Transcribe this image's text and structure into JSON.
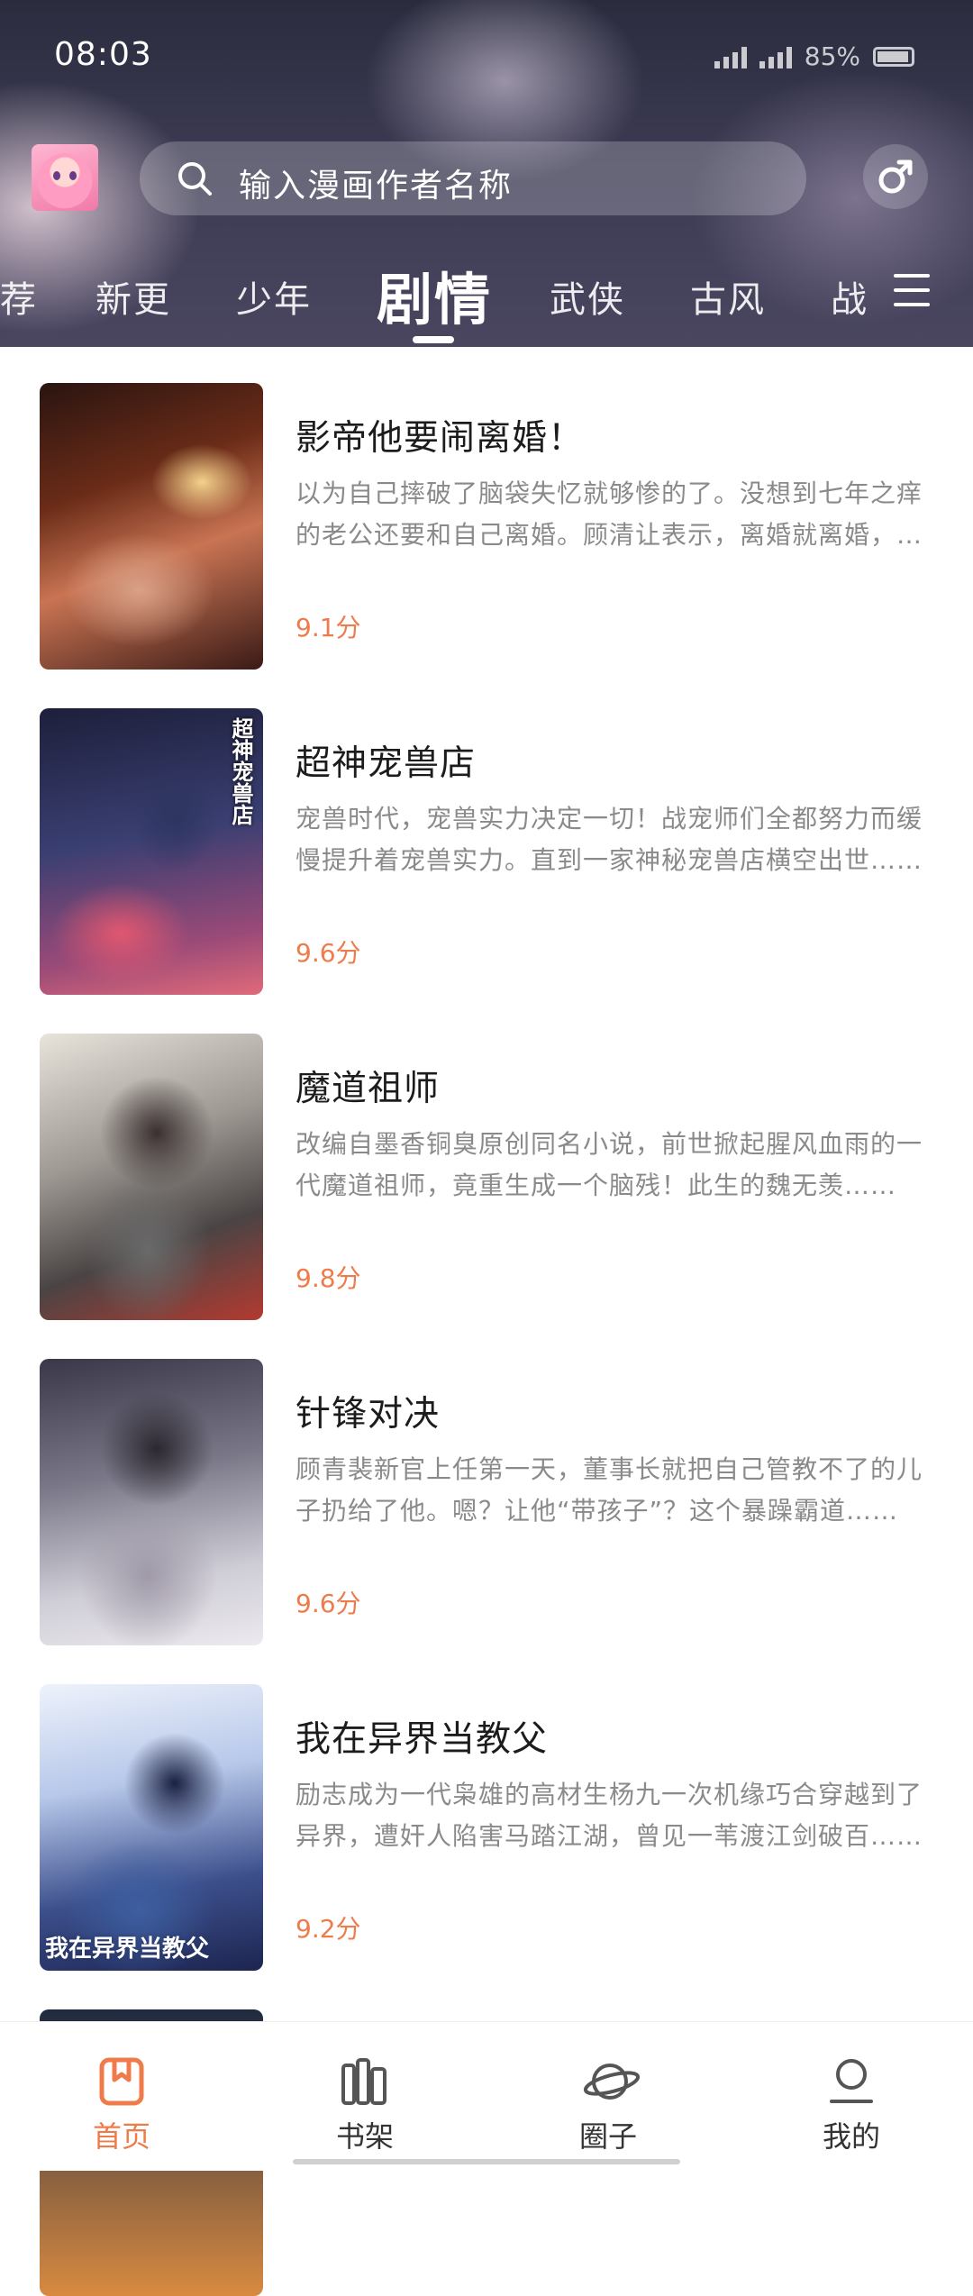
{
  "status_bar": {
    "time": "08:03",
    "battery": "85%"
  },
  "header": {
    "search_placeholder": "输入漫画作者名称"
  },
  "tabs": [
    {
      "label": "荐"
    },
    {
      "label": "新更"
    },
    {
      "label": "少年"
    },
    {
      "label": "剧情",
      "active": true
    },
    {
      "label": "武侠"
    },
    {
      "label": "古风"
    },
    {
      "label": "战"
    }
  ],
  "comics": [
    {
      "title": "影帝他要闹离婚！",
      "desc": "以为自己摔破了脑袋失忆就够惨的了。没想到七年之痒的老公还要和自己离婚。顾清让表示，离婚就离婚，谁怕谁！",
      "score": "9.1分"
    },
    {
      "title": "超神宠兽店",
      "desc": "宠兽时代，宠兽实力决定一切！战宠师们全都努力而缓慢提升着宠兽实力。直到一家神秘宠兽店横空出世……",
      "score": "9.6分",
      "cover_text": "超神宠兽店"
    },
    {
      "title": "魔道祖师",
      "desc": "改编自墨香铜臭原创同名小说，前世掀起腥风血雨的一代魔道祖师，竟重生成一个脑残！此生的魏无羡……",
      "score": "9.8分"
    },
    {
      "title": "针锋对决",
      "desc": "顾青裴新官上任第一天，董事长就把自己管教不了的儿子扔给了他。嗯？让他“带孩子”？这个暴躁霸道……",
      "score": "9.6分"
    },
    {
      "title": "我在异界当教父",
      "desc": "励志成为一代枭雄的高材生杨九一次机缘巧合穿越到了异界，遭奸人陷害马踏江湖，曾见一苇渡江剑破百……",
      "score": "9.2分",
      "cover_text": "我在异界当教父"
    }
  ],
  "bottom_nav": [
    {
      "label": "首页",
      "icon": "bookmark-icon",
      "active": true
    },
    {
      "label": "书架",
      "icon": "bookshelf-icon"
    },
    {
      "label": "圈子",
      "icon": "planet-icon"
    },
    {
      "label": "我的",
      "icon": "profile-icon"
    }
  ],
  "colors": {
    "accent": "#f07b4a",
    "title_text": "#1c1c1c",
    "desc_text": "#8a8a8a"
  }
}
